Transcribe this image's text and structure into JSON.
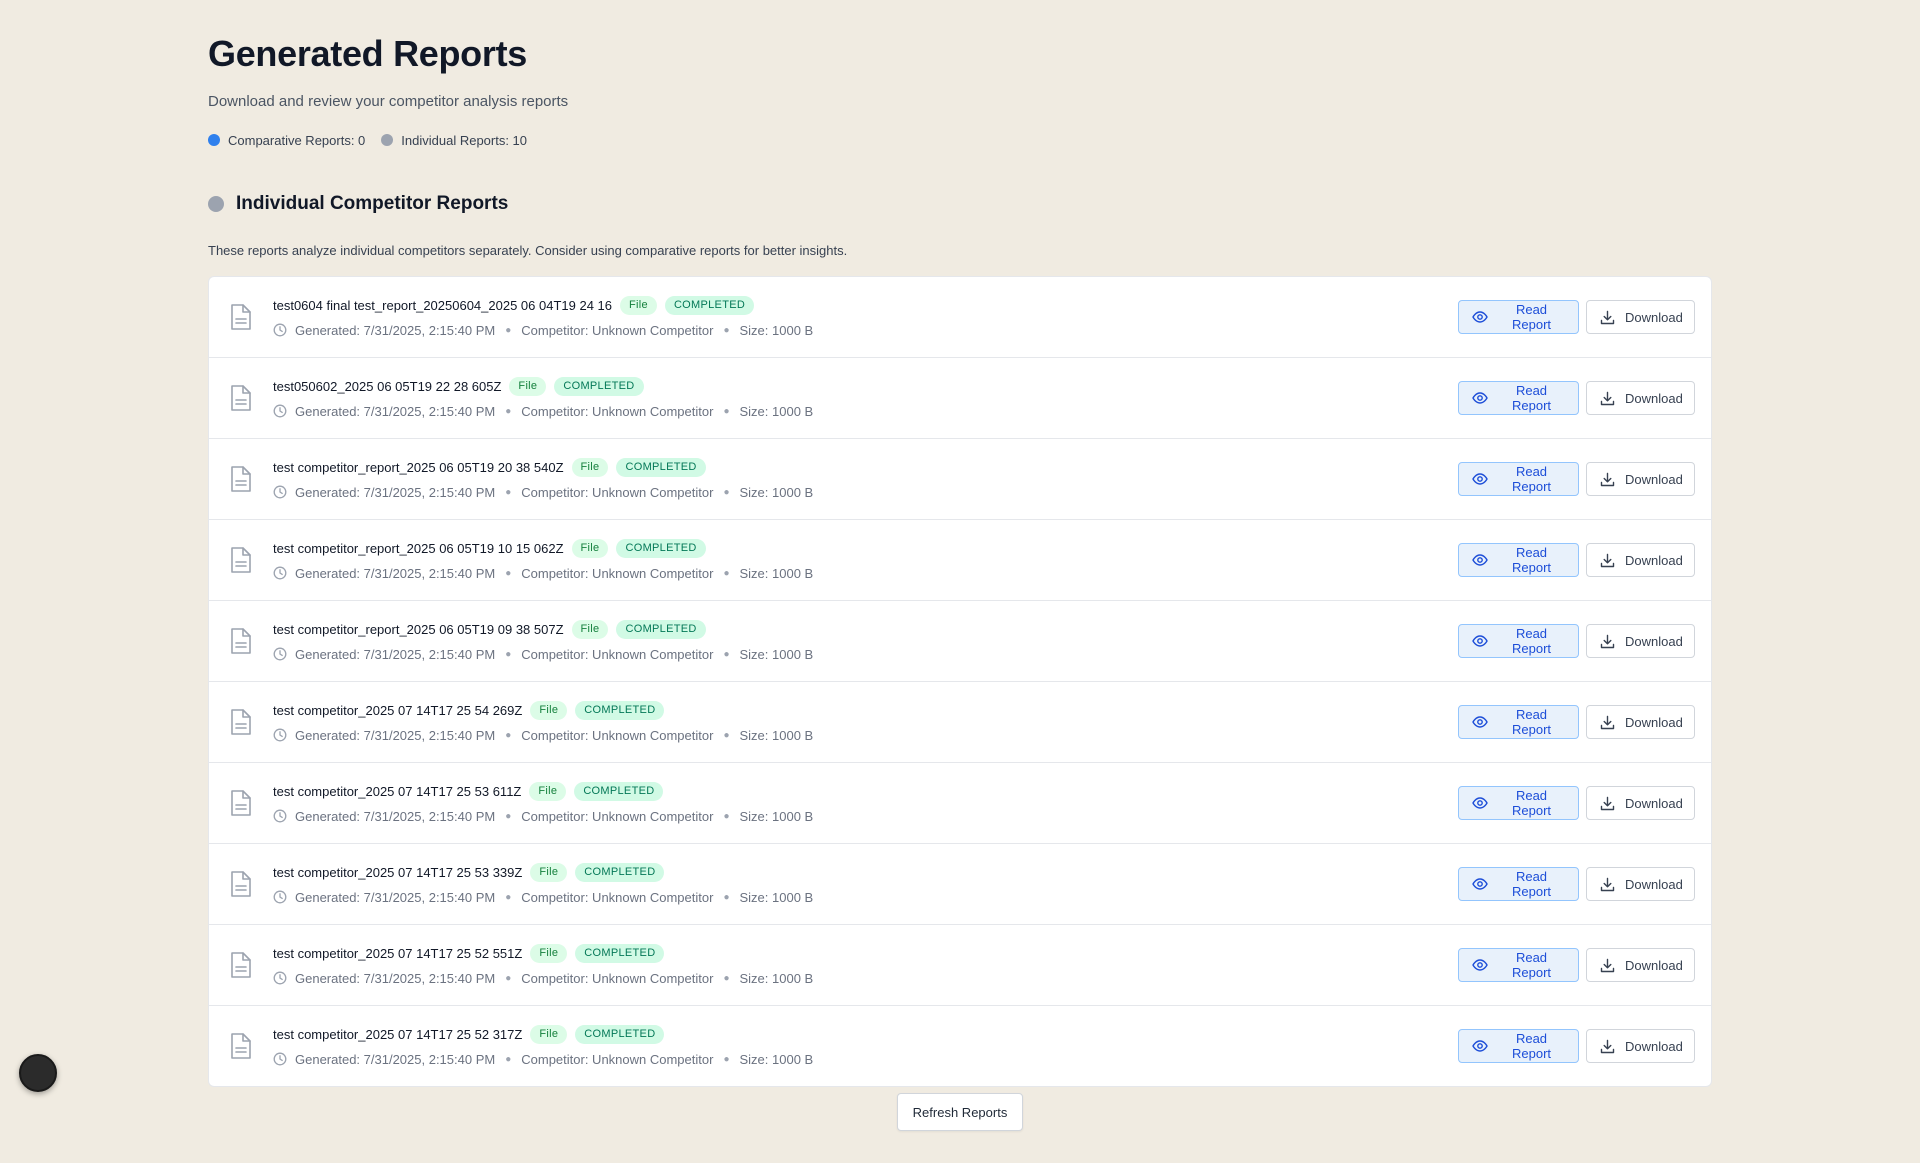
{
  "header": {
    "title": "Generated Reports",
    "subtitle": "Download and review your competitor analysis reports"
  },
  "counts": {
    "comparative_label": "Comparative Reports: 0",
    "individual_label": "Individual Reports: 10",
    "comparative_color": "#2f80ed",
    "individual_color": "#9ca3af"
  },
  "section": {
    "title": "Individual Competitor Reports",
    "description": "These reports analyze individual competitors separately. Consider using comparative reports for better insights."
  },
  "buttons": {
    "read_label": "Read Report",
    "download_label": "Download",
    "refresh_label": "Refresh Reports"
  },
  "icons": {
    "document": "file-text-icon",
    "clock": "clock-icon",
    "eye": "eye-icon",
    "download": "download-icon"
  },
  "reports": [
    {
      "name": "test0604 final test_report_20250604_2025 06 04T19 24 16",
      "type": "File",
      "status": "COMPLETED",
      "generated": "Generated: 7/31/2025, 2:15:40 PM",
      "competitor": "Competitor: Unknown Competitor",
      "size": "Size: 1000 B"
    },
    {
      "name": "test050602_2025 06 05T19 22 28 605Z",
      "type": "File",
      "status": "COMPLETED",
      "generated": "Generated: 7/31/2025, 2:15:40 PM",
      "competitor": "Competitor: Unknown Competitor",
      "size": "Size: 1000 B"
    },
    {
      "name": "test competitor_report_2025 06 05T19 20 38 540Z",
      "type": "File",
      "status": "COMPLETED",
      "generated": "Generated: 7/31/2025, 2:15:40 PM",
      "competitor": "Competitor: Unknown Competitor",
      "size": "Size: 1000 B"
    },
    {
      "name": "test competitor_report_2025 06 05T19 10 15 062Z",
      "type": "File",
      "status": "COMPLETED",
      "generated": "Generated: 7/31/2025, 2:15:40 PM",
      "competitor": "Competitor: Unknown Competitor",
      "size": "Size: 1000 B"
    },
    {
      "name": "test competitor_report_2025 06 05T19 09 38 507Z",
      "type": "File",
      "status": "COMPLETED",
      "generated": "Generated: 7/31/2025, 2:15:40 PM",
      "competitor": "Competitor: Unknown Competitor",
      "size": "Size: 1000 B"
    },
    {
      "name": "test competitor_2025 07 14T17 25 54 269Z",
      "type": "File",
      "status": "COMPLETED",
      "generated": "Generated: 7/31/2025, 2:15:40 PM",
      "competitor": "Competitor: Unknown Competitor",
      "size": "Size: 1000 B"
    },
    {
      "name": "test competitor_2025 07 14T17 25 53 611Z",
      "type": "File",
      "status": "COMPLETED",
      "generated": "Generated: 7/31/2025, 2:15:40 PM",
      "competitor": "Competitor: Unknown Competitor",
      "size": "Size: 1000 B"
    },
    {
      "name": "test competitor_2025 07 14T17 25 53 339Z",
      "type": "File",
      "status": "COMPLETED",
      "generated": "Generated: 7/31/2025, 2:15:40 PM",
      "competitor": "Competitor: Unknown Competitor",
      "size": "Size: 1000 B"
    },
    {
      "name": "test competitor_2025 07 14T17 25 52 551Z",
      "type": "File",
      "status": "COMPLETED",
      "generated": "Generated: 7/31/2025, 2:15:40 PM",
      "competitor": "Competitor: Unknown Competitor",
      "size": "Size: 1000 B"
    },
    {
      "name": "test competitor_2025 07 14T17 25 52 317Z",
      "type": "File",
      "status": "COMPLETED",
      "generated": "Generated: 7/31/2025, 2:15:40 PM",
      "competitor": "Competitor: Unknown Competitor",
      "size": "Size: 1000 B"
    }
  ]
}
